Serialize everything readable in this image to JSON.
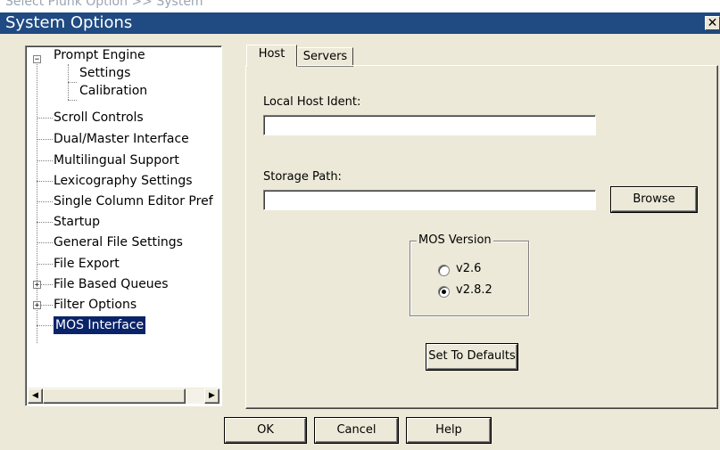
{
  "background_caption": "Select Plunk Option >> System",
  "window": {
    "title": "System Options",
    "close_glyph": "✕"
  },
  "tree": {
    "items": [
      {
        "label": "Prompt Engine",
        "expander": "−"
      },
      {
        "label": "Settings"
      },
      {
        "label": "Calibration"
      },
      {
        "label": "Scroll Controls"
      },
      {
        "label": "Dual/Master Interface"
      },
      {
        "label": "Multilingual Support"
      },
      {
        "label": "Lexicography Settings"
      },
      {
        "label": "Single Column Editor Pref"
      },
      {
        "label": "Startup"
      },
      {
        "label": "General File Settings"
      },
      {
        "label": "File Export"
      },
      {
        "label": "File Based Queues",
        "expander": "+"
      },
      {
        "label": "Filter Options",
        "expander": "+"
      },
      {
        "label": "MOS Interface",
        "selected": true
      }
    ],
    "scroll_left_glyph": "◀",
    "scroll_right_glyph": "▶"
  },
  "tabs": [
    {
      "label": "Host",
      "active": true
    },
    {
      "label": "Servers",
      "active": false
    }
  ],
  "host": {
    "local_host_label": "Local Host Ident:",
    "local_host_value": "",
    "storage_path_label": "Storage Path:",
    "storage_path_value": "",
    "browse_label": "Browse",
    "mos_version_label": "MOS Version",
    "mos_versions": [
      {
        "label": "v2.6",
        "checked": false
      },
      {
        "label": "v2.8.2",
        "checked": true
      }
    ],
    "defaults_label": "Set To Defaults"
  },
  "footer": {
    "ok_label": "OK",
    "cancel_label": "Cancel",
    "help_label": "Help"
  },
  "colors": {
    "titlebar": "#1f4a82",
    "face": "#ece9d8",
    "selection": "#0a246a"
  }
}
